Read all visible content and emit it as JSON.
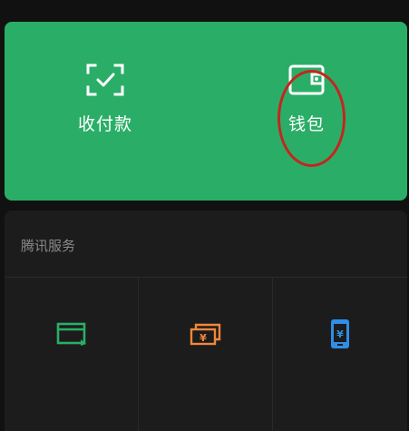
{
  "top_panel": {
    "background_color": "#2aae67",
    "items": [
      {
        "label": "收付款",
        "icon": "scan-check-icon"
      },
      {
        "label": "钱包",
        "icon": "wallet-icon"
      }
    ]
  },
  "annotation": {
    "shape": "ellipse",
    "color": "#c4261f",
    "target": "钱包"
  },
  "services": {
    "header": "腾讯服务",
    "items": [
      {
        "icon": "card-repayment-icon",
        "color": "#2aae67"
      },
      {
        "icon": "wealth-management-icon",
        "color": "#f0883a"
      },
      {
        "icon": "phone-topup-icon",
        "color": "#2f8ee8"
      }
    ]
  }
}
